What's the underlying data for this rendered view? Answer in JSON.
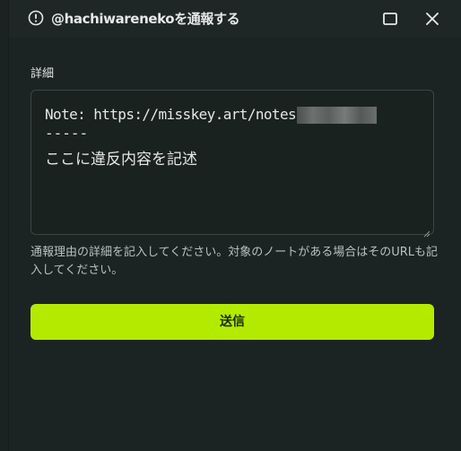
{
  "dialog": {
    "title": "@hachiwarenekoを通報する",
    "alert_icon": "alert-circle-icon",
    "maximize_icon": "maximize-icon",
    "close_icon": "close-icon"
  },
  "form": {
    "section_label": "詳細",
    "textarea": {
      "line1": "Note: https://misskey.art/notes/",
      "line2": "-----",
      "line3": "ここに違反内容を記述"
    },
    "hint": "通報理由の詳細を記入してください。対象のノートがある場合はそのURLも記入してください。",
    "submit_label": "送信"
  },
  "colors": {
    "background": "#1b2422",
    "accent": "#b4ea00",
    "text": "#e4e7e6"
  }
}
